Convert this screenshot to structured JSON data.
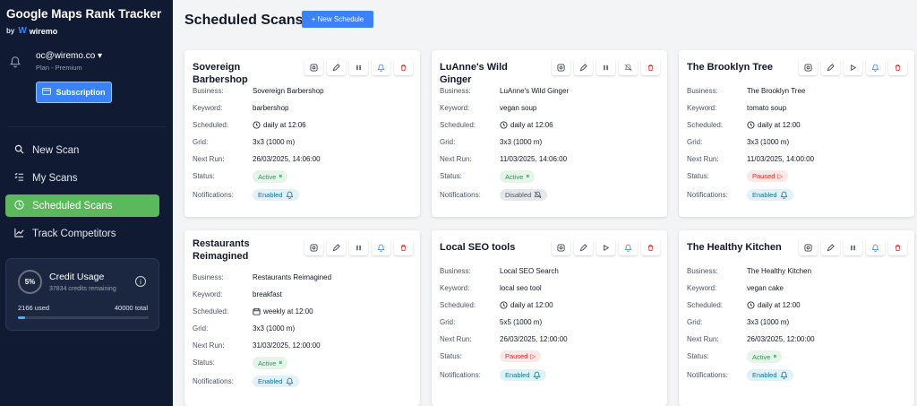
{
  "app": {
    "title": "Google Maps Rank Tracker",
    "by": "by",
    "brand": "wiremo",
    "brand_mark": "W"
  },
  "account": {
    "email": "oc@wiremo.co ▾",
    "plan": "Plan - Premium",
    "subscription_label": "Subscription"
  },
  "nav": [
    {
      "label": "New Scan",
      "icon": "search-icon",
      "active": false
    },
    {
      "label": "My Scans",
      "icon": "list-icon",
      "active": false
    },
    {
      "label": "Scheduled Scans",
      "icon": "clock-icon",
      "active": true
    },
    {
      "label": "Track Competitors",
      "icon": "chart-icon",
      "active": false
    }
  ],
  "credits": {
    "percent": "5%",
    "title": "Credit Usage",
    "remaining": "37834 credits remaining",
    "used": "2166 used",
    "total": "40000 total",
    "fill_fraction": 0.054,
    "info": "i"
  },
  "page": {
    "title": "Scheduled Scans",
    "new_schedule_label": "+ New Schedule"
  },
  "labels": {
    "business": "Business:",
    "keyword": "Keyword:",
    "scheduled": "Scheduled:",
    "grid": "Grid:",
    "next_run": "Next Run:",
    "status": "Status:",
    "notifications": "Notifications:"
  },
  "colors": {
    "accent": "#3b82f6",
    "sidebar": "#101b33",
    "active_nav": "#5cb85c",
    "danger": "#dc2626",
    "success": "#16a34a"
  },
  "cards": [
    {
      "title": "Sovereign Barbershop",
      "business": "Sovereign Barbershop",
      "keyword": "barbershop",
      "scheduled": "daily at 12:06",
      "schedule_icon": "clock-icon",
      "grid": "3x3 (1000 m)",
      "next_run": "26/03/2025, 14:06:00",
      "status": "Active",
      "status_kind": "active",
      "notifications": "Enabled",
      "notif_kind": "enabled",
      "toggle_icon": "pause-icon",
      "bell_icon": "bell-icon"
    },
    {
      "title": "LuAnne's Wild Ginger",
      "business": "LuAnne's Wild Ginger",
      "keyword": "vegan soup",
      "scheduled": "daily at 12:06",
      "schedule_icon": "clock-icon",
      "grid": "3x3 (1000 m)",
      "next_run": "11/03/2025, 14:06:00",
      "status": "Active",
      "status_kind": "active",
      "notifications": "Disabled",
      "notif_kind": "disabled",
      "toggle_icon": "pause-icon",
      "bell_icon": "bell-off-icon"
    },
    {
      "title": "The Brooklyn Tree",
      "business": "The Brooklyn Tree",
      "keyword": "tomato soup",
      "scheduled": "daily at 12:00",
      "schedule_icon": "clock-icon",
      "grid": "3x3 (1000 m)",
      "next_run": "11/03/2025, 14:00:00",
      "status": "Paused",
      "status_kind": "paused",
      "notifications": "Enabled",
      "notif_kind": "enabled",
      "toggle_icon": "play-icon",
      "bell_icon": "bell-icon"
    },
    {
      "title": "Restaurants Reimagined",
      "business": "Restaurants Reimagined",
      "keyword": "breakfast",
      "scheduled": "weekly at 12:00",
      "schedule_icon": "calendar-icon",
      "grid": "3x3 (1000 m)",
      "next_run": "31/03/2025, 12:00:00",
      "status": "Active",
      "status_kind": "active",
      "notifications": "Enabled",
      "notif_kind": "enabled",
      "toggle_icon": "pause-icon",
      "bell_icon": "bell-icon"
    },
    {
      "title": "Local SEO tools",
      "business": "Local SEO Search",
      "keyword": "local seo tool",
      "scheduled": "daily at 12:00",
      "schedule_icon": "clock-icon",
      "grid": "5x5 (1000 m)",
      "next_run": "26/03/2025, 12:00:00",
      "status": "Paused",
      "status_kind": "paused",
      "notifications": "Enabled",
      "notif_kind": "enabled",
      "toggle_icon": "play-icon",
      "bell_icon": "bell-icon"
    },
    {
      "title": "The Healthy Kitchen",
      "business": "The Healthy Kitchen",
      "keyword": "vegan cake",
      "scheduled": "daily at 12:00",
      "schedule_icon": "clock-icon",
      "grid": "3x3 (1000 m)",
      "next_run": "26/03/2025, 12:00:00",
      "status": "Active",
      "status_kind": "active",
      "notifications": "Enabled",
      "notif_kind": "enabled",
      "toggle_icon": "pause-icon",
      "bell_icon": "bell-icon"
    }
  ]
}
